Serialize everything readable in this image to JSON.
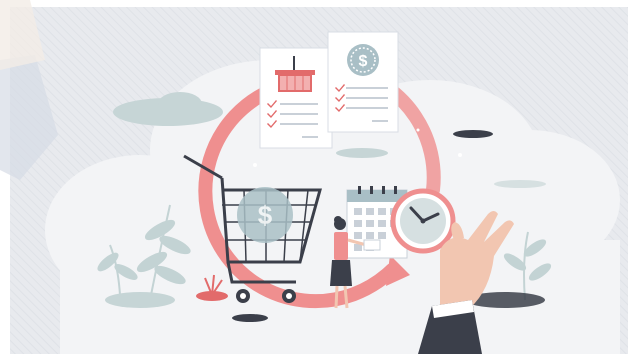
{
  "illustration": {
    "palette": {
      "background": "#e8eaee",
      "cloud": "#f3f4f6",
      "accent_pink": "#ef8f8f",
      "basket_red": "#e26b6b",
      "leaf_teal": "#c3d3d4",
      "dark": "#3b3f4a",
      "dollar_teal": "#a9bfc6"
    },
    "icons": [
      "shopping-cart-icon",
      "shopping-basket-icon",
      "dollar-coin-icon",
      "calendar-icon",
      "clock-icon",
      "checklist-icon",
      "circular-arrow-icon"
    ]
  }
}
